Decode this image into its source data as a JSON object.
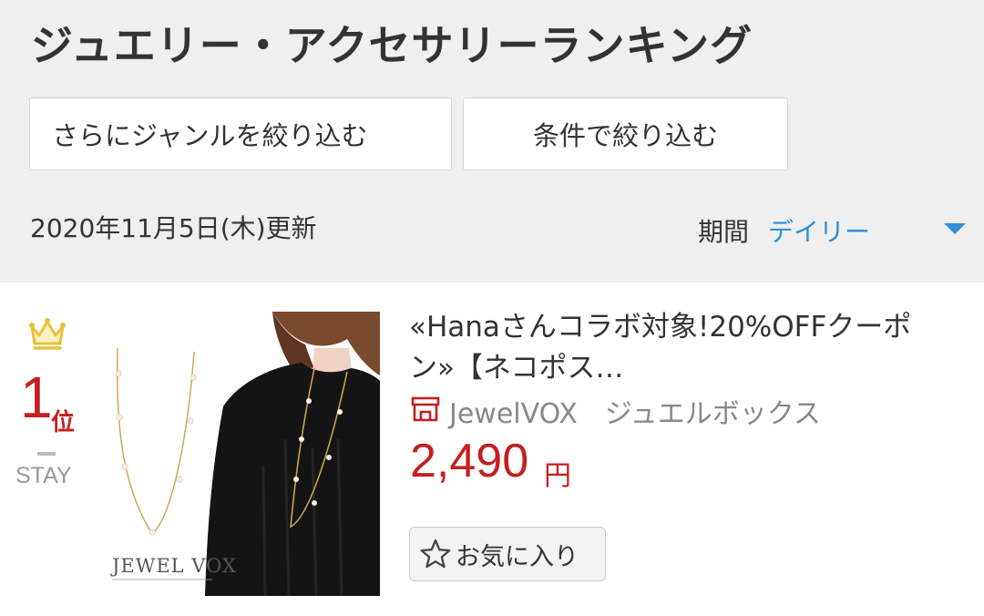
{
  "page": {
    "title": "ジュエリー・アクセサリーランキング"
  },
  "filters": {
    "genre_label": "さらにジャンルを絞り込む",
    "condition_label": "条件で絞り込む"
  },
  "update": {
    "text": "2020年11月5日(木)更新"
  },
  "period": {
    "label": "期間",
    "value": "デイリー"
  },
  "ranking": [
    {
      "rank": "1",
      "rank_suffix": "位",
      "rank_change": "STAY",
      "title": "«Hanaさんコラボ対象!20%OFFクーポン»【ネコポス…",
      "shop_name": "JewelVOX　ジュエルボックス",
      "price": "2,490",
      "price_unit": "円",
      "favorite_label": "お気に入り",
      "image_brand": "JEWEL VOX"
    }
  ],
  "icons": {
    "crown": "crown-icon",
    "shop": "shop-icon",
    "favorite": "star-outline-icon",
    "dropdown": "triangle-down-icon"
  },
  "colors": {
    "accent_blue": "#2f8fd8",
    "rank_red": "#c51f1f",
    "header_bg": "#efefef",
    "crown_gold": "#e8c23a"
  }
}
